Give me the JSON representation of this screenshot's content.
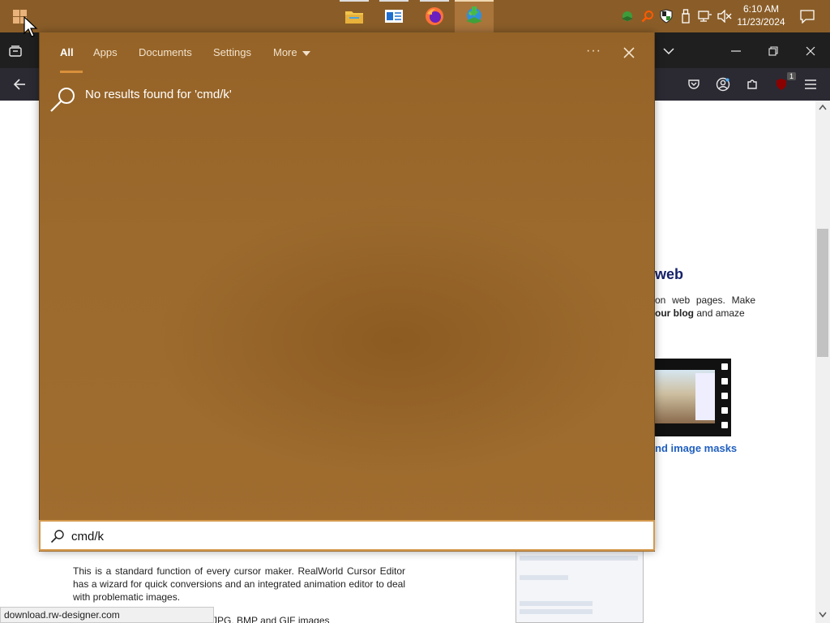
{
  "taskbar": {
    "apps": [
      {
        "name": "File Explorer",
        "icon": "folder-icon"
      },
      {
        "name": "Microsoft Store / News",
        "icon": "news-icon"
      },
      {
        "name": "Firefox",
        "icon": "firefox-icon"
      },
      {
        "name": "Internet Download Manager",
        "icon": "globe-download-icon",
        "active": true
      }
    ],
    "tray_icons": [
      "refresh-globe-icon",
      "search-magnifier-icon",
      "shield-icon",
      "usb-icon",
      "network-icon",
      "volume-muted-icon"
    ],
    "clock": {
      "time": "6:10 AM",
      "date": "11/23/2024"
    },
    "notification_icon": "notification-icon"
  },
  "search_panel": {
    "tabs": [
      {
        "label": "All",
        "active": true
      },
      {
        "label": "Apps"
      },
      {
        "label": "Documents"
      },
      {
        "label": "Settings"
      },
      {
        "label": "More"
      }
    ],
    "ellipsis": "···",
    "no_results": "No results found for 'cmd/k'",
    "query": "cmd/k"
  },
  "browser": {
    "extension_badge": "1",
    "page": {
      "heading_fragment": "web",
      "para_line1": "on web pages. Make",
      "para_link": "our blog",
      "para_line2_rest": "and amaze",
      "image_masks_link": "nd image masks",
      "lower_paragraph": "This is a standard function of every cursor maker. RealWorld Cursor Editor has a wizard for quick conversions and an integrated animation editor to deal with problematic images.",
      "lower_fragment": "JPG, BMP and GIF images"
    },
    "status_url": "download.rw-designer.com"
  },
  "colors": {
    "taskbar": "#8a5d28",
    "panel": "#9c6a2d",
    "accent": "#d9903c"
  }
}
